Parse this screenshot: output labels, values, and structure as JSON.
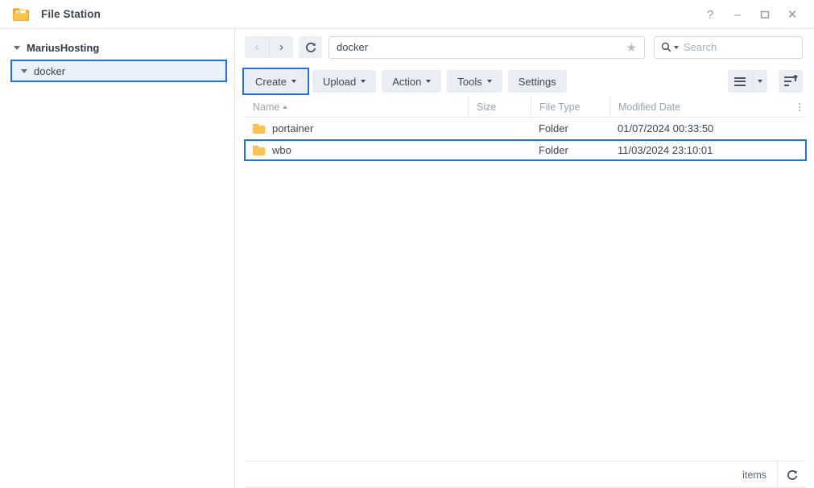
{
  "window": {
    "title": "File Station",
    "app_icon": "folder-icon",
    "controls": [
      {
        "name": "help",
        "glyph": "?"
      },
      {
        "name": "minimize",
        "glyph": "–"
      },
      {
        "name": "maximize",
        "glyph": "□"
      },
      {
        "name": "close",
        "glyph": "✕"
      }
    ]
  },
  "sidebar": {
    "root": {
      "label": "MariusHosting",
      "expanded": true
    },
    "child": {
      "label": "docker",
      "expanded": true,
      "selected": true,
      "highlight": true
    }
  },
  "toolbar": {
    "nav_back": "‹",
    "nav_forward": "›",
    "refresh_icon": "⟳",
    "path_value": "docker",
    "path_placeholder": "",
    "favorite_icon": "★",
    "search_icon": "Q",
    "search_placeholder": "Search",
    "buttons": [
      {
        "label": "Create",
        "caret": true,
        "highlight": true
      },
      {
        "label": "Upload",
        "caret": true,
        "highlight": false
      },
      {
        "label": "Action",
        "caret": true,
        "highlight": false
      },
      {
        "label": "Tools",
        "caret": true,
        "highlight": false
      },
      {
        "label": "Settings",
        "caret": false,
        "highlight": false
      }
    ],
    "view_mode_icon": "list-view-icon",
    "sort_icon": "sort-descending-icon"
  },
  "filelist": {
    "columns": [
      {
        "key": "name",
        "label": "Name",
        "sorted": "asc"
      },
      {
        "key": "size",
        "label": "Size"
      },
      {
        "key": "ftype",
        "label": "File Type"
      },
      {
        "key": "mdate",
        "label": "Modified Date"
      }
    ],
    "rows": [
      {
        "name": "portainer",
        "size": "",
        "ftype": "Folder",
        "mdate": "01/07/2024 00:33:50",
        "icon": "folder-icon",
        "highlight": false
      },
      {
        "name": "wbo",
        "size": "",
        "ftype": "Folder",
        "mdate": "11/03/2024 23:10:01",
        "icon": "folder-icon",
        "highlight": true
      }
    ]
  },
  "statusbar": {
    "items_label": "items",
    "refresh_icon": "⟳"
  },
  "colors": {
    "annotation": "#1a73e8",
    "folder": "#fbc356",
    "selection_bg": "#e9f1fb",
    "button_bg": "#eaeef4",
    "border": "#dfe5ec"
  }
}
